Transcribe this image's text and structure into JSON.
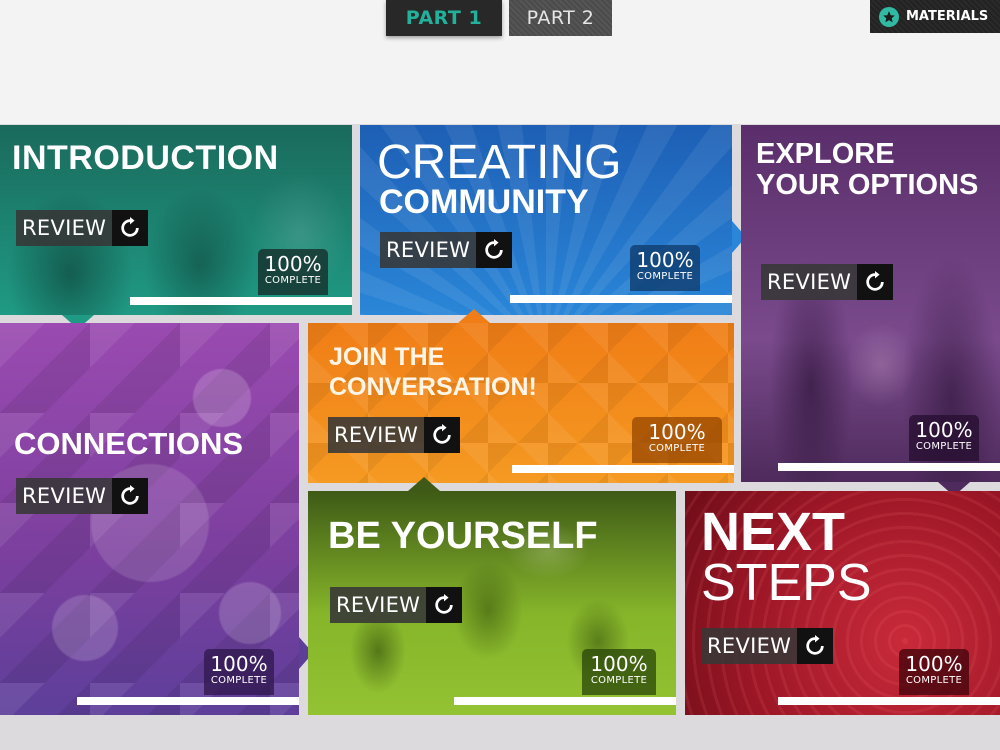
{
  "header": {
    "tabs": [
      {
        "label": "PART 1",
        "active": true
      },
      {
        "label": "PART 2",
        "active": false
      }
    ],
    "materials_label": "MATERIALS",
    "materials_icon": "star-icon"
  },
  "review_icon": "replay-icon",
  "tiles": [
    {
      "id": "introduction",
      "title_lines": [
        "INTRODUCTION"
      ],
      "review_label": "REVIEW",
      "percent": "100%",
      "complete_label": "COMPLETE",
      "progress": 1.0,
      "color": "#1d8f7c"
    },
    {
      "id": "creating-community",
      "title_lines": [
        "CREATING",
        "COMMUNITY"
      ],
      "review_label": "REVIEW",
      "percent": "100%",
      "complete_label": "COMPLETE",
      "progress": 1.0,
      "color": "#2271c4"
    },
    {
      "id": "explore-your-options",
      "title_lines": [
        "EXPLORE",
        "YOUR OPTIONS"
      ],
      "review_label": "REVIEW",
      "percent": "100%",
      "complete_label": "COMPLETE",
      "progress": 1.0,
      "color": "#6b3a7e"
    },
    {
      "id": "connections",
      "title_lines": [
        "CONNECTIONS"
      ],
      "review_label": "REVIEW",
      "percent": "100%",
      "complete_label": "COMPLETE",
      "progress": 1.0,
      "color": "#8b48a8"
    },
    {
      "id": "join-the-conversation",
      "title_lines": [
        "JOIN THE",
        "CONVERSATION!"
      ],
      "review_label": "REVIEW",
      "percent": "100%",
      "complete_label": "COMPLETE",
      "progress": 1.0,
      "color": "#f0891b"
    },
    {
      "id": "be-yourself",
      "title_lines": [
        "BE YOURSELF"
      ],
      "review_label": "REVIEW",
      "percent": "100%",
      "complete_label": "COMPLETE",
      "progress": 1.0,
      "color": "#7aa824"
    },
    {
      "id": "next-steps",
      "title_lines": [
        "NEXT",
        "STEPS"
      ],
      "review_label": "REVIEW",
      "percent": "100%",
      "complete_label": "COMPLETE",
      "progress": 1.0,
      "color": "#a81a2a"
    }
  ]
}
